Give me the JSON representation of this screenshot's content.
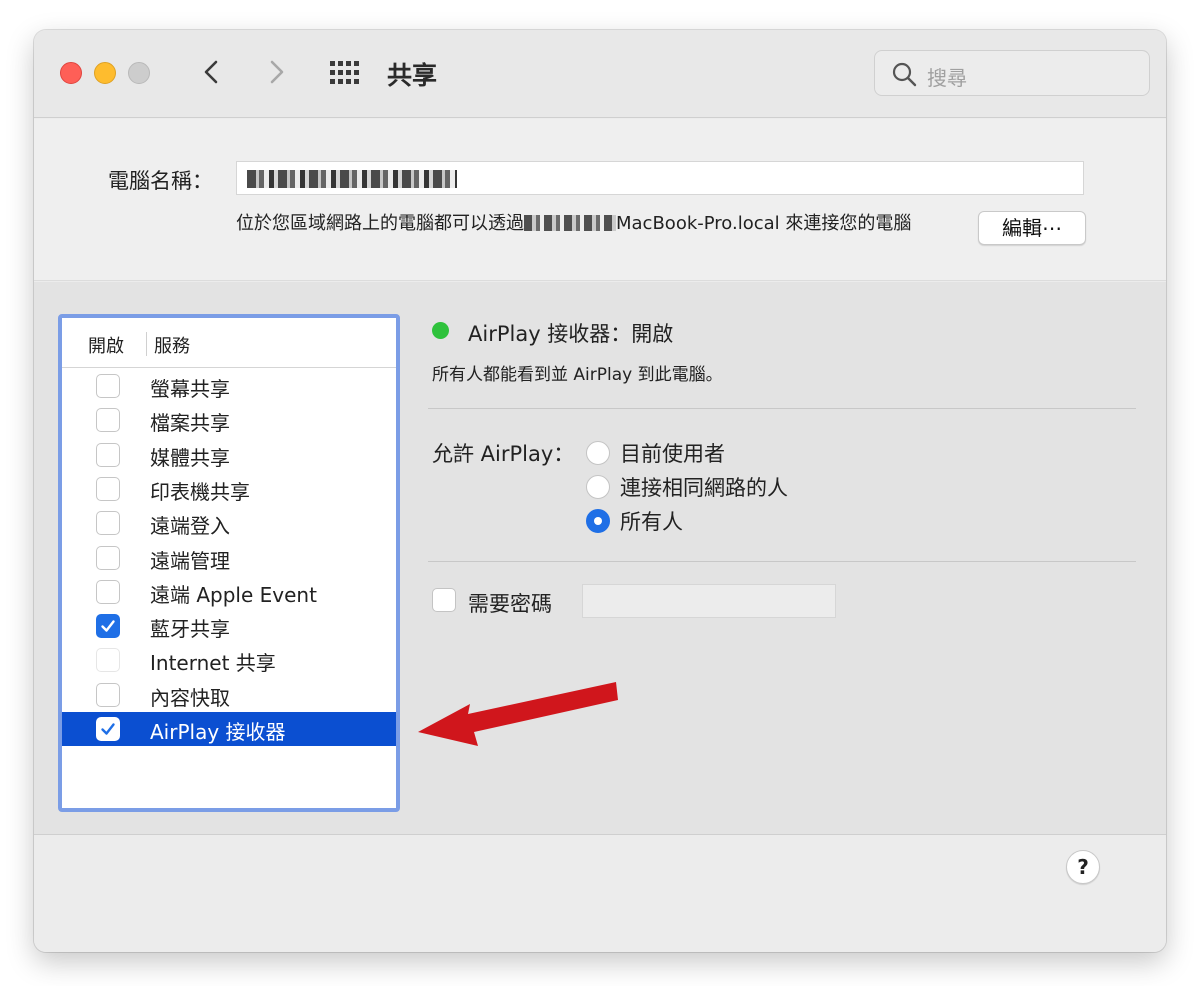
{
  "window": {
    "title": "共享",
    "search": {
      "placeholder": "搜尋",
      "icon": "magnifier-icon"
    }
  },
  "computer_name": {
    "label": "電腦名稱：",
    "description_prefix": "位於您區域網路上的電腦都可以透過",
    "description_suffix": "MacBook-Pro.local 來連接您的電腦",
    "edit_label": "編輯⋯"
  },
  "services": {
    "header_open": "開啟",
    "header_service": "服務",
    "items": [
      {
        "label": "螢幕共享",
        "checked": false
      },
      {
        "label": "檔案共享",
        "checked": false
      },
      {
        "label": "媒體共享",
        "checked": false
      },
      {
        "label": "印表機共享",
        "checked": false
      },
      {
        "label": "遠端登入",
        "checked": false
      },
      {
        "label": "遠端管理",
        "checked": false
      },
      {
        "label": "遠端 Apple Event",
        "checked": false
      },
      {
        "label": "藍牙共享",
        "checked": true
      },
      {
        "label": "Internet 共享",
        "checked": false
      },
      {
        "label": "內容快取",
        "checked": false
      },
      {
        "label": "AirPlay 接收器",
        "checked": true,
        "selected": true
      }
    ]
  },
  "detail": {
    "status_title": "AirPlay 接收器：開啟",
    "status_color": "#2fc23c",
    "status_desc": "所有人都能看到並 AirPlay 到此電腦。",
    "allow_label": "允許 AirPlay：",
    "options": [
      {
        "label": "目前使用者",
        "selected": false
      },
      {
        "label": "連接相同網路的人",
        "selected": false
      },
      {
        "label": "所有人",
        "selected": true
      }
    ],
    "password_label": "需要密碼",
    "password_value": ""
  },
  "help_label": "?",
  "accent_color": "#1f6fe6",
  "selection_color": "#0b4fd1",
  "annotation_arrow_color": "#d0161c"
}
